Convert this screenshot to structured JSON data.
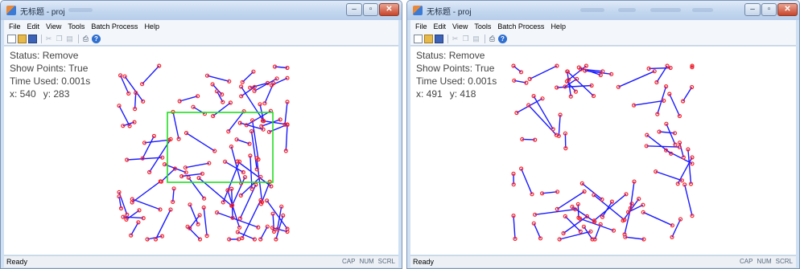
{
  "windows": {
    "left": {
      "title": "无标题 - proj",
      "menu": [
        "File",
        "Edit",
        "View",
        "Tools",
        "Batch Process",
        "Help"
      ],
      "info": {
        "status": "Status: Remove",
        "show_points": "Show Points: True",
        "time_used": "Time Used: 0.001s",
        "x": "x: 540",
        "y": "y: 283"
      },
      "status_bar": {
        "left": "Ready",
        "indicators": [
          "CAP",
          "NUM",
          "SCRL"
        ]
      }
    },
    "right": {
      "title": "无标题 - proj",
      "menu": [
        "File",
        "Edit",
        "View",
        "Tools",
        "Batch Process",
        "Help"
      ],
      "info": {
        "status": "Status: Remove",
        "show_points": "Show Points: True",
        "time_used": "Time Used: 0.001s",
        "x": "x: 491",
        "y": "y: 418"
      },
      "status_bar": {
        "left": "Ready",
        "indicators": [
          "CAP",
          "NUM",
          "SCRL"
        ]
      }
    }
  },
  "window_controls": {
    "minimize": "–",
    "maximize": "▫",
    "close": "✕"
  },
  "toolbar_icons": [
    "new-file-icon",
    "open-folder-icon",
    "save-disk-icon",
    "cut-icon",
    "copy-icon",
    "paste-icon",
    "print-icon",
    "help-icon"
  ],
  "drawing": {
    "segment_color": "#1a1aff",
    "point_color": "#ff2020",
    "selection_color": "#22dd22",
    "segment_count_left": 80,
    "segment_count_right": 62
  }
}
